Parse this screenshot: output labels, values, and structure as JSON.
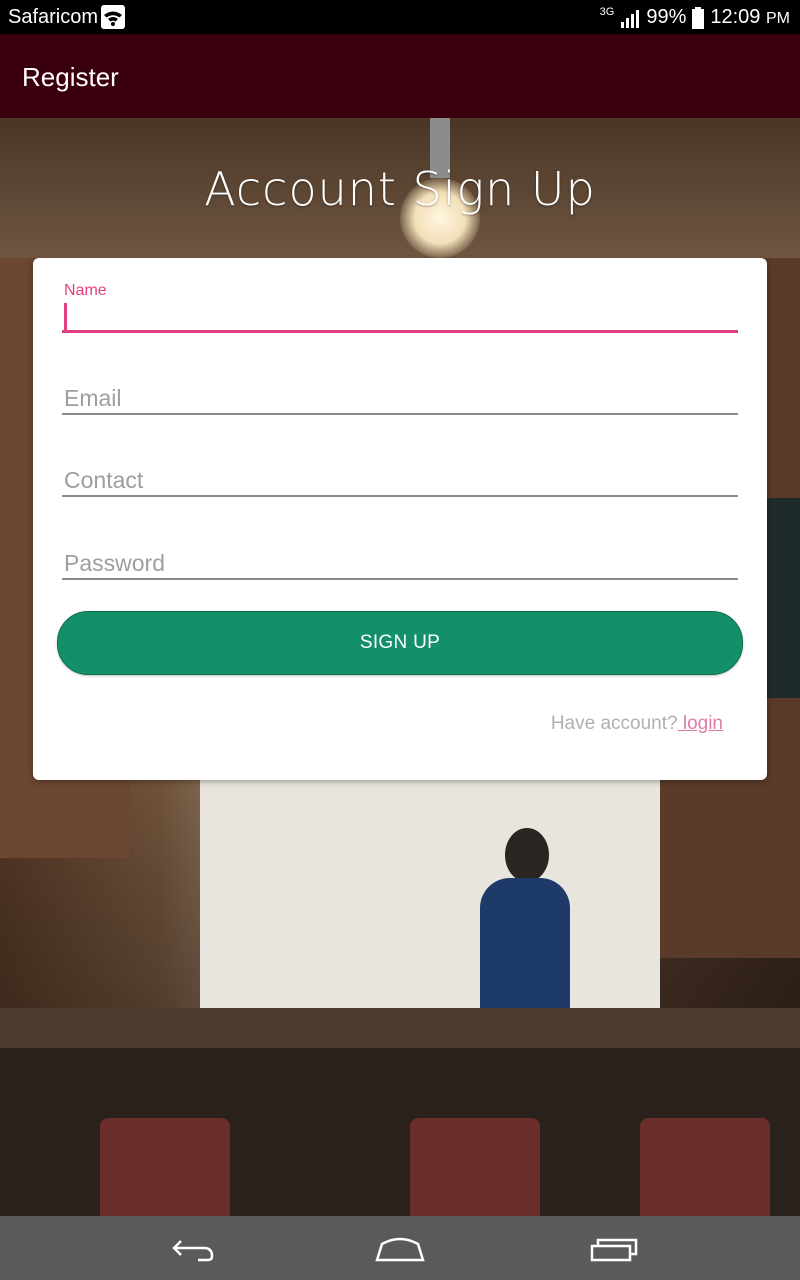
{
  "status_bar": {
    "carrier": "Safaricom",
    "network": "3G",
    "battery": "99%",
    "time": "12:09",
    "ampm": "PM"
  },
  "app_bar": {
    "title": "Register"
  },
  "heading": "Account Sign Up",
  "form": {
    "name_label": "Name",
    "name_value": "",
    "email_placeholder": "Email",
    "contact_placeholder": "Contact",
    "password_placeholder": "Password",
    "signup_label": "SIGN UP",
    "have_account": "Have account?",
    "login_link": " login"
  },
  "colors": {
    "app_bar": "#3b0010",
    "accent": "#e0407f",
    "button": "#13906a",
    "nav_bar": "#5a5a5a"
  },
  "nav": {
    "icons": [
      "back-icon",
      "home-icon",
      "recents-icon"
    ]
  }
}
